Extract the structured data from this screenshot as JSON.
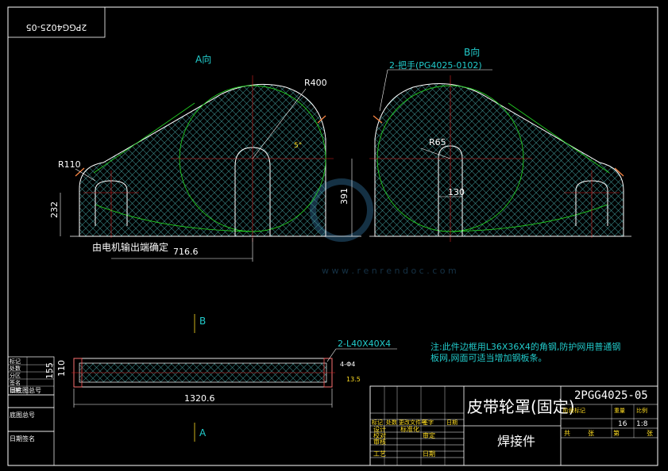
{
  "drawing": {
    "code_stamp": "2PGG4025-05",
    "view_a_label": "A向",
    "view_b_label": "B向",
    "dim_r400": "R400",
    "dim_r110": "R110",
    "dim_r65": "R65",
    "dim_232": "232",
    "dim_391": "391",
    "dim_130": "130",
    "dim_7166": "716.6",
    "dim_13206": "1320.6",
    "dim_155": "155",
    "dim_110": "110",
    "dim_angle": "5°",
    "handle_callout": "2-把手(PG4025-0102)",
    "angle_callout": "2-L40X40X4",
    "motor_note": "由电机输出端确定",
    "section_b": "B",
    "section_a": "A",
    "small_dim_1": "4-Φ4",
    "small_dim_2": "13.5",
    "note_line1": "注:此件边框用L36X36X4的角钢,防护网用普通钢",
    "note_line2": "板网,网面可适当增加钢板条。",
    "title_name": "皮带轮罩(固定)",
    "title_code": "2PGG4025-05",
    "title_type": "焊接件",
    "scale": "1:8",
    "qty": "16",
    "left_strip": [
      "标记",
      "处数",
      "分区",
      "签名",
      "日期"
    ],
    "left_labels": [
      "旧底图总号",
      "底图总号",
      "日期签名"
    ],
    "tb_rows": [
      [
        "标记",
        "处数",
        "更改文件号",
        "签字",
        "日期"
      ],
      [
        "设计",
        "",
        "标准化",
        ""
      ],
      [
        "校对",
        "",
        "审定",
        ""
      ],
      [
        "审核",
        "",
        "",
        ""
      ],
      [
        "工艺",
        "",
        "日期",
        ""
      ]
    ],
    "tb_right_small": [
      "阶段标记",
      "重量",
      "比例"
    ],
    "tb_right_bottom": [
      "共",
      "张",
      "第",
      "张"
    ],
    "watermark_url": "w w w . r e n r e n d o c . c o m"
  }
}
